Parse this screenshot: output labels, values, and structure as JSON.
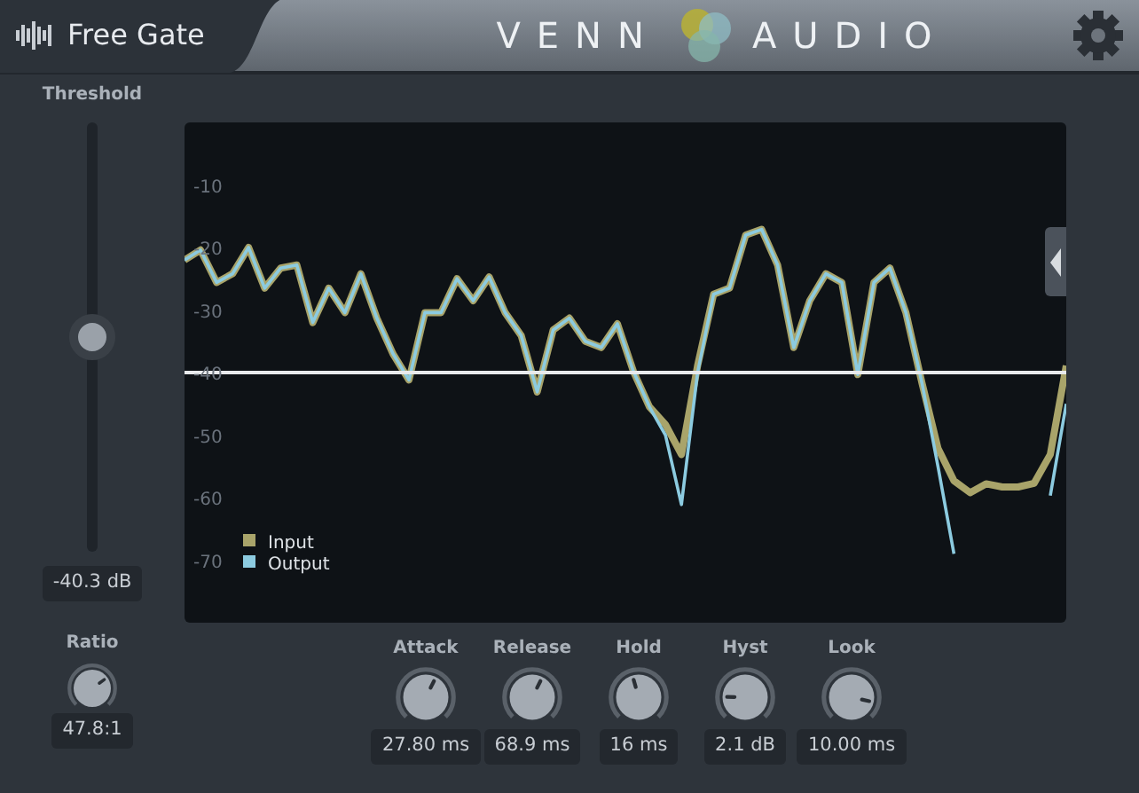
{
  "header": {
    "plugin_name": "Free Gate",
    "brand_left": "VENN",
    "brand_right": "AUDIO"
  },
  "threshold": {
    "label": "Threshold",
    "level": 0.5,
    "reading": "-40.3 dB"
  },
  "ratio": {
    "label": "Ratio",
    "reading": "47.8:1"
  },
  "chart": {
    "chart_data": {
      "type": "line",
      "ylim": [
        -80,
        0
      ],
      "legend": "lower left",
      "yticks": [
        -10,
        -20,
        -30,
        -40,
        -50,
        -60,
        -70
      ],
      "categories": [
        null,
        null,
        null,
        null,
        null,
        null,
        null,
        null,
        null,
        null,
        null,
        null,
        null,
        null,
        null,
        null,
        null,
        null,
        null,
        null,
        null,
        null,
        null,
        null,
        null,
        null,
        null,
        null,
        null,
        null,
        null,
        null,
        null,
        null,
        null,
        null,
        null,
        null,
        null,
        null,
        null,
        null,
        null,
        null,
        null,
        null,
        null,
        null,
        null,
        null,
        null,
        null,
        null,
        null,
        null,
        null
      ],
      "series": [
        {
          "name": "Input",
          "color": "#a9a46a",
          "values": [
            -22,
            -20.4,
            -25.6,
            -24.2,
            -20,
            -26.5,
            -23.3,
            -22.8,
            -32,
            -26.5,
            -30.4,
            -24.2,
            -31.3,
            -37,
            -41.2,
            -30.4,
            -30.4,
            -25,
            -28.5,
            -24.7,
            -30.4,
            -34.1,
            -43.1,
            -33.2,
            -31.3,
            -35,
            -36,
            -32.2,
            -39.8,
            -45.5,
            -48.3,
            -53.1,
            -38.9,
            -27.5,
            -26.5,
            -18,
            -17.1,
            -22.8,
            -36,
            -28.5,
            -24.2,
            -25.6,
            -40.3,
            -25.6,
            -23.3,
            -30.4,
            -41.7,
            -52.1,
            -57.3,
            -59.2,
            -57.8,
            -58.3,
            -58.3,
            -57.7,
            -53.1,
            -38.9
          ]
        },
        {
          "name": "Output",
          "color": "#8ccbe0",
          "values": [
            -22,
            -20.4,
            -25.6,
            -24.2,
            -20,
            -26.5,
            -23.3,
            -22.8,
            -32,
            -26.5,
            -30.4,
            -24.2,
            -31.3,
            -37,
            -41.2,
            -30.4,
            -30.4,
            -25,
            -28.5,
            -24.7,
            -30.4,
            -34.1,
            -43.1,
            -33.2,
            -31.3,
            -35,
            -36,
            -32.2,
            -39.8,
            -45.5,
            -50,
            -61.1,
            -40,
            -27.5,
            -26.5,
            -18,
            -17.1,
            -22.8,
            -36,
            -28.5,
            -24.2,
            -25.6,
            -40.3,
            -25.6,
            -23.3,
            -30.4,
            -41.7,
            -55,
            -69,
            null,
            null,
            null,
            null,
            null,
            -59.7,
            -45
          ]
        }
      ],
      "ref_lines": [
        {
          "axis": "y",
          "value": -40
        }
      ]
    }
  },
  "knobs": [
    {
      "label": "Attack",
      "reading": "27.80 ms"
    },
    {
      "label": "Release",
      "reading": "68.9 ms"
    },
    {
      "label": "Hold",
      "reading": "16 ms"
    },
    {
      "label": "Hyst",
      "reading": "2.1 dB"
    },
    {
      "label": "Look",
      "reading": "10.00 ms"
    }
  ]
}
